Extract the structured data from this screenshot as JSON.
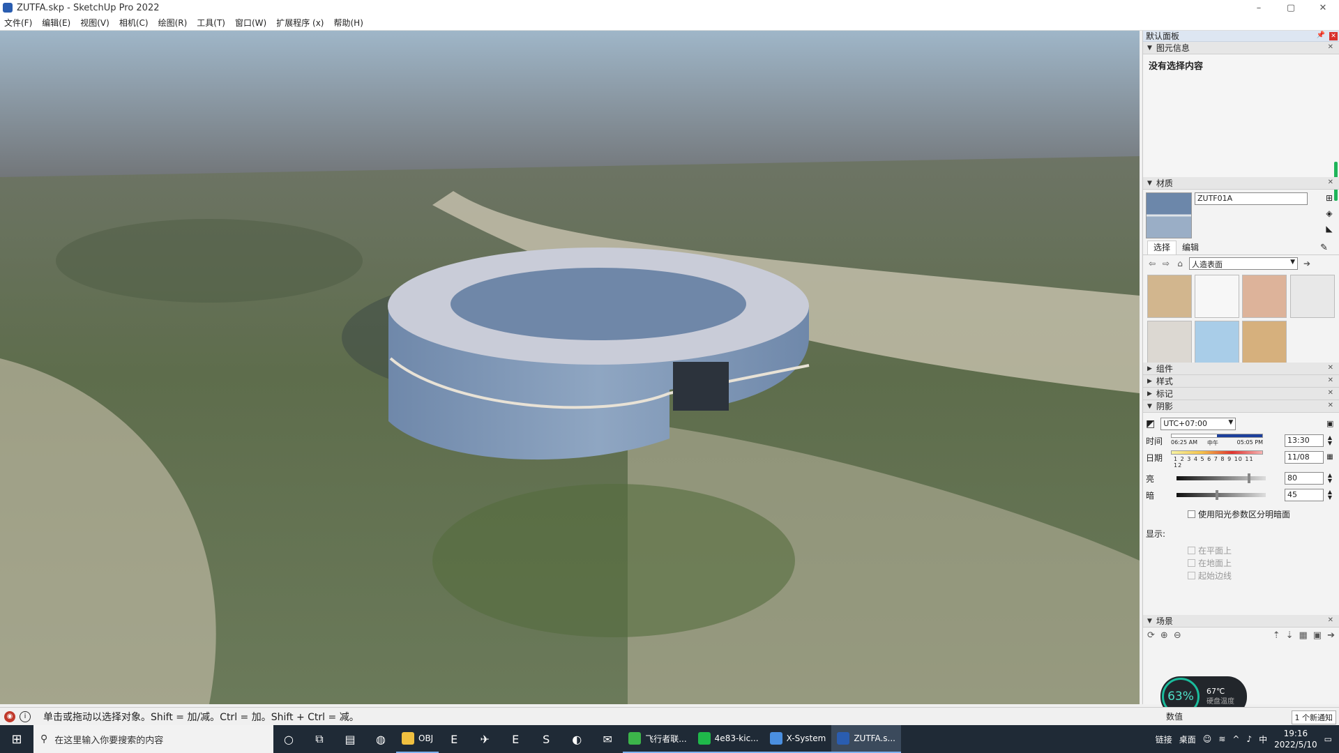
{
  "window": {
    "title": "ZUTFA.skp - SketchUp Pro 2022",
    "controls": [
      "–",
      "▢",
      "✕"
    ]
  },
  "menu": [
    "文件(F)",
    "编辑(E)",
    "视图(V)",
    "相机(C)",
    "绘图(R)",
    "工具(T)",
    "窗口(W)",
    "扩展程序 (x)",
    "帮助(H)"
  ],
  "tray_panel": {
    "title": "默认面板",
    "entity_info": {
      "header": "图元信息",
      "empty_text": "没有选择内容"
    },
    "materials": {
      "header": "材质",
      "material_name": "ZUTF01A",
      "tab_select": "选择",
      "tab_edit": "编辑",
      "library": "人造表面",
      "swatch_colors": [
        "#d2b68e",
        "#f7f7f7",
        "#ddb39a",
        "#dcd8d2",
        "#a9cde8",
        "#d6b07d"
      ]
    },
    "collapsed_sections": [
      "组件",
      "样式",
      "标记"
    ],
    "shadows": {
      "header": "阴影",
      "timezone": "UTC+07:00",
      "time_label": "时间",
      "time_start": "06:25 AM",
      "time_mid": "中午",
      "time_end": "05:05 PM",
      "time_value": "13:30",
      "date_label": "日期",
      "months": "1 2 3 4 5 6 7 8 9 10 11 12",
      "date_value": "11/08",
      "light_label": "亮",
      "light_value": "80",
      "dark_label": "暗",
      "dark_value": "45",
      "use_sun_label": "使用阳光参数区分明暗面",
      "display_label": "显示:",
      "on_faces": "在平面上",
      "on_ground": "在地面上",
      "from_edges": "起始边线"
    },
    "scenes": {
      "header": "场景"
    }
  },
  "perf_widget": {
    "cpu": "63%",
    "temp": "67℃",
    "temp_label": "硬盘温度"
  },
  "status": {
    "message": "单击或拖动以选择对象。Shift = 加/减。Ctrl = 加。Shift + Ctrl = 减。",
    "measurements_label": "数值",
    "notification": "1 个新通知"
  },
  "taskbar": {
    "search_placeholder": "在这里输入你要搜索的内容",
    "apps": [
      {
        "label": "OBJ",
        "color": "#f0c040"
      },
      {
        "label": "飞行者联...",
        "color": "#3cb54a"
      },
      {
        "label": "4e83-kic...",
        "color": "#1fb84a"
      },
      {
        "label": "X-System",
        "color": "#4a8fe0"
      },
      {
        "label": "ZUTFA.s...",
        "color": "#2a5db0"
      }
    ],
    "tray_links": "链接",
    "tray_desktop": "桌面",
    "ime": "中",
    "time": "19:16",
    "date": "2022/5/10"
  }
}
